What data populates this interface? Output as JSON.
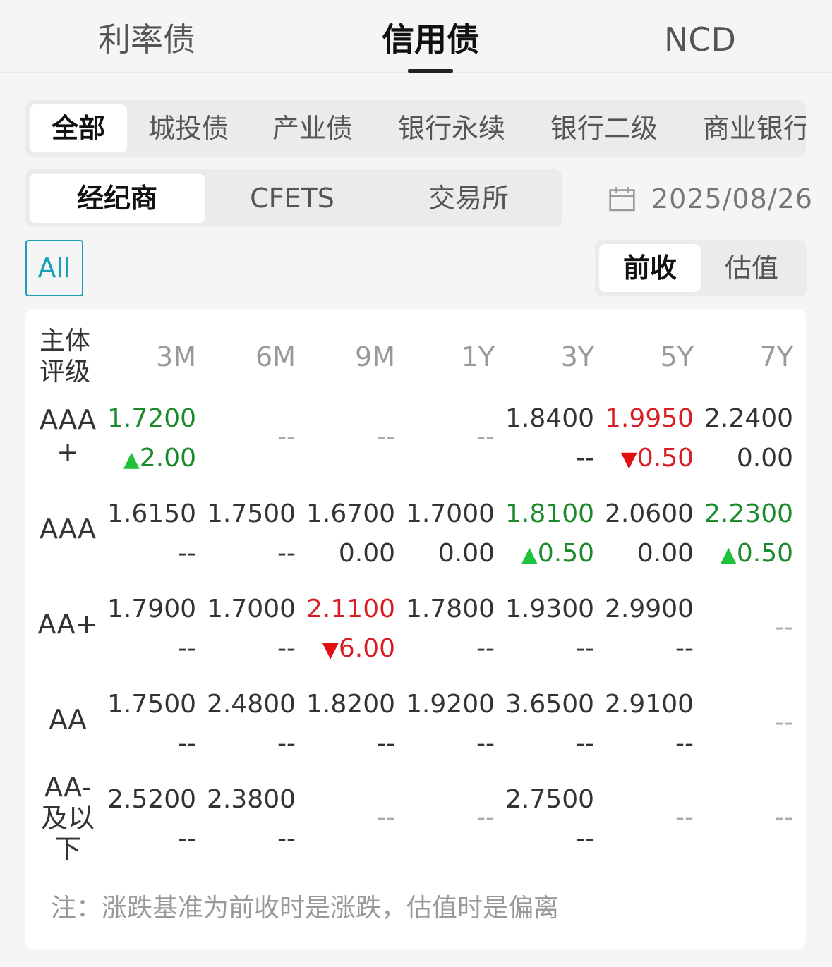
{
  "top_tabs": [
    "利率债",
    "信用债",
    "NCD"
  ],
  "categories": [
    "全部",
    "城投债",
    "产业债",
    "银行永续",
    "银行二级",
    "商业银行"
  ],
  "sources": [
    "经纪商",
    "CFETS",
    "交易所"
  ],
  "date": "2025/08/26",
  "all_button": "All",
  "price_toggle": [
    "前收",
    "估值"
  ],
  "table": {
    "rating_header": "主体评级",
    "columns": [
      "3M",
      "6M",
      "9M",
      "1Y",
      "3Y",
      "5Y",
      "7Y"
    ],
    "rows": [
      {
        "rating": "AAA+",
        "cells": [
          {
            "value": "1.7200",
            "change": "2.00",
            "dir": "up",
            "color": "green"
          },
          null,
          null,
          null,
          {
            "value": "1.8400",
            "change": "--",
            "dir": "",
            "color": ""
          },
          {
            "value": "1.9950",
            "change": "0.50",
            "dir": "down",
            "color": "red"
          },
          {
            "value": "2.2400",
            "change": "0.00",
            "dir": "",
            "color": ""
          }
        ]
      },
      {
        "rating": "AAA",
        "cells": [
          {
            "value": "1.6150",
            "change": "--",
            "dir": "",
            "color": ""
          },
          {
            "value": "1.7500",
            "change": "--",
            "dir": "",
            "color": ""
          },
          {
            "value": "1.6700",
            "change": "0.00",
            "dir": "",
            "color": ""
          },
          {
            "value": "1.7000",
            "change": "0.00",
            "dir": "",
            "color": ""
          },
          {
            "value": "1.8100",
            "change": "0.50",
            "dir": "up",
            "color": "green"
          },
          {
            "value": "2.0600",
            "change": "0.00",
            "dir": "",
            "color": ""
          },
          {
            "value": "2.2300",
            "change": "0.50",
            "dir": "up",
            "color": "green"
          }
        ]
      },
      {
        "rating": "AA+",
        "cells": [
          {
            "value": "1.7900",
            "change": "--",
            "dir": "",
            "color": ""
          },
          {
            "value": "1.7000",
            "change": "--",
            "dir": "",
            "color": ""
          },
          {
            "value": "2.1100",
            "change": "6.00",
            "dir": "down",
            "color": "red"
          },
          {
            "value": "1.7800",
            "change": "--",
            "dir": "",
            "color": ""
          },
          {
            "value": "1.9300",
            "change": "--",
            "dir": "",
            "color": ""
          },
          {
            "value": "2.9900",
            "change": "--",
            "dir": "",
            "color": ""
          },
          null
        ]
      },
      {
        "rating": "AA",
        "cells": [
          {
            "value": "1.7500",
            "change": "--",
            "dir": "",
            "color": ""
          },
          {
            "value": "2.4800",
            "change": "--",
            "dir": "",
            "color": ""
          },
          {
            "value": "1.8200",
            "change": "--",
            "dir": "",
            "color": ""
          },
          {
            "value": "1.9200",
            "change": "--",
            "dir": "",
            "color": ""
          },
          {
            "value": "3.6500",
            "change": "--",
            "dir": "",
            "color": ""
          },
          {
            "value": "2.9100",
            "change": "--",
            "dir": "",
            "color": ""
          },
          null
        ]
      },
      {
        "rating": "AA-及以下",
        "cells": [
          {
            "value": "2.5200",
            "change": "--",
            "dir": "",
            "color": ""
          },
          {
            "value": "2.3800",
            "change": "--",
            "dir": "",
            "color": ""
          },
          null,
          null,
          {
            "value": "2.7500",
            "change": "--",
            "dir": "",
            "color": ""
          },
          null,
          null
        ]
      }
    ],
    "empty_mark": "--"
  },
  "note": "注：涨跌基准为前收时是涨跌，估值时是偏离",
  "colors": {
    "accent": "#1aa0b5",
    "up": "#1a8a2a",
    "down": "#d81e24"
  }
}
